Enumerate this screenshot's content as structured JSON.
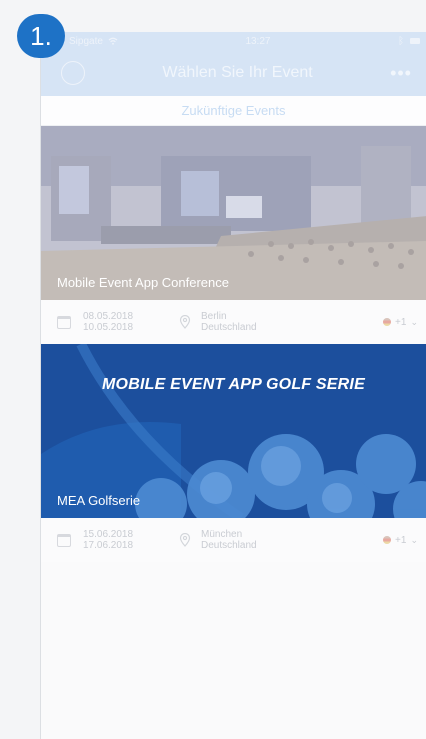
{
  "step_badge": "1.",
  "status_bar": {
    "carrier": "Sipgate",
    "time": "13:27"
  },
  "nav": {
    "title": "Wählen Sie Ihr Event",
    "more": "•••"
  },
  "section_label": "Zukünftige Events",
  "events": [
    {
      "title": "Mobile Event App Conference",
      "date_start": "08.05.2018",
      "date_end": "10.05.2018",
      "city": "Berlin",
      "country": "Deutschland",
      "lang_extra": "+1"
    },
    {
      "headline": "MOBILE EVENT APP GOLF SERIE",
      "title": "MEA Golfserie",
      "date_start": "15.06.2018",
      "date_end": "17.06.2018",
      "city": "München",
      "country": "Deutschland",
      "lang_extra": "+1"
    }
  ],
  "icons": [
    "profile-icon",
    "more-icon",
    "calendar-icon",
    "location-pin-icon",
    "flag-icon",
    "chevron-down-icon"
  ]
}
